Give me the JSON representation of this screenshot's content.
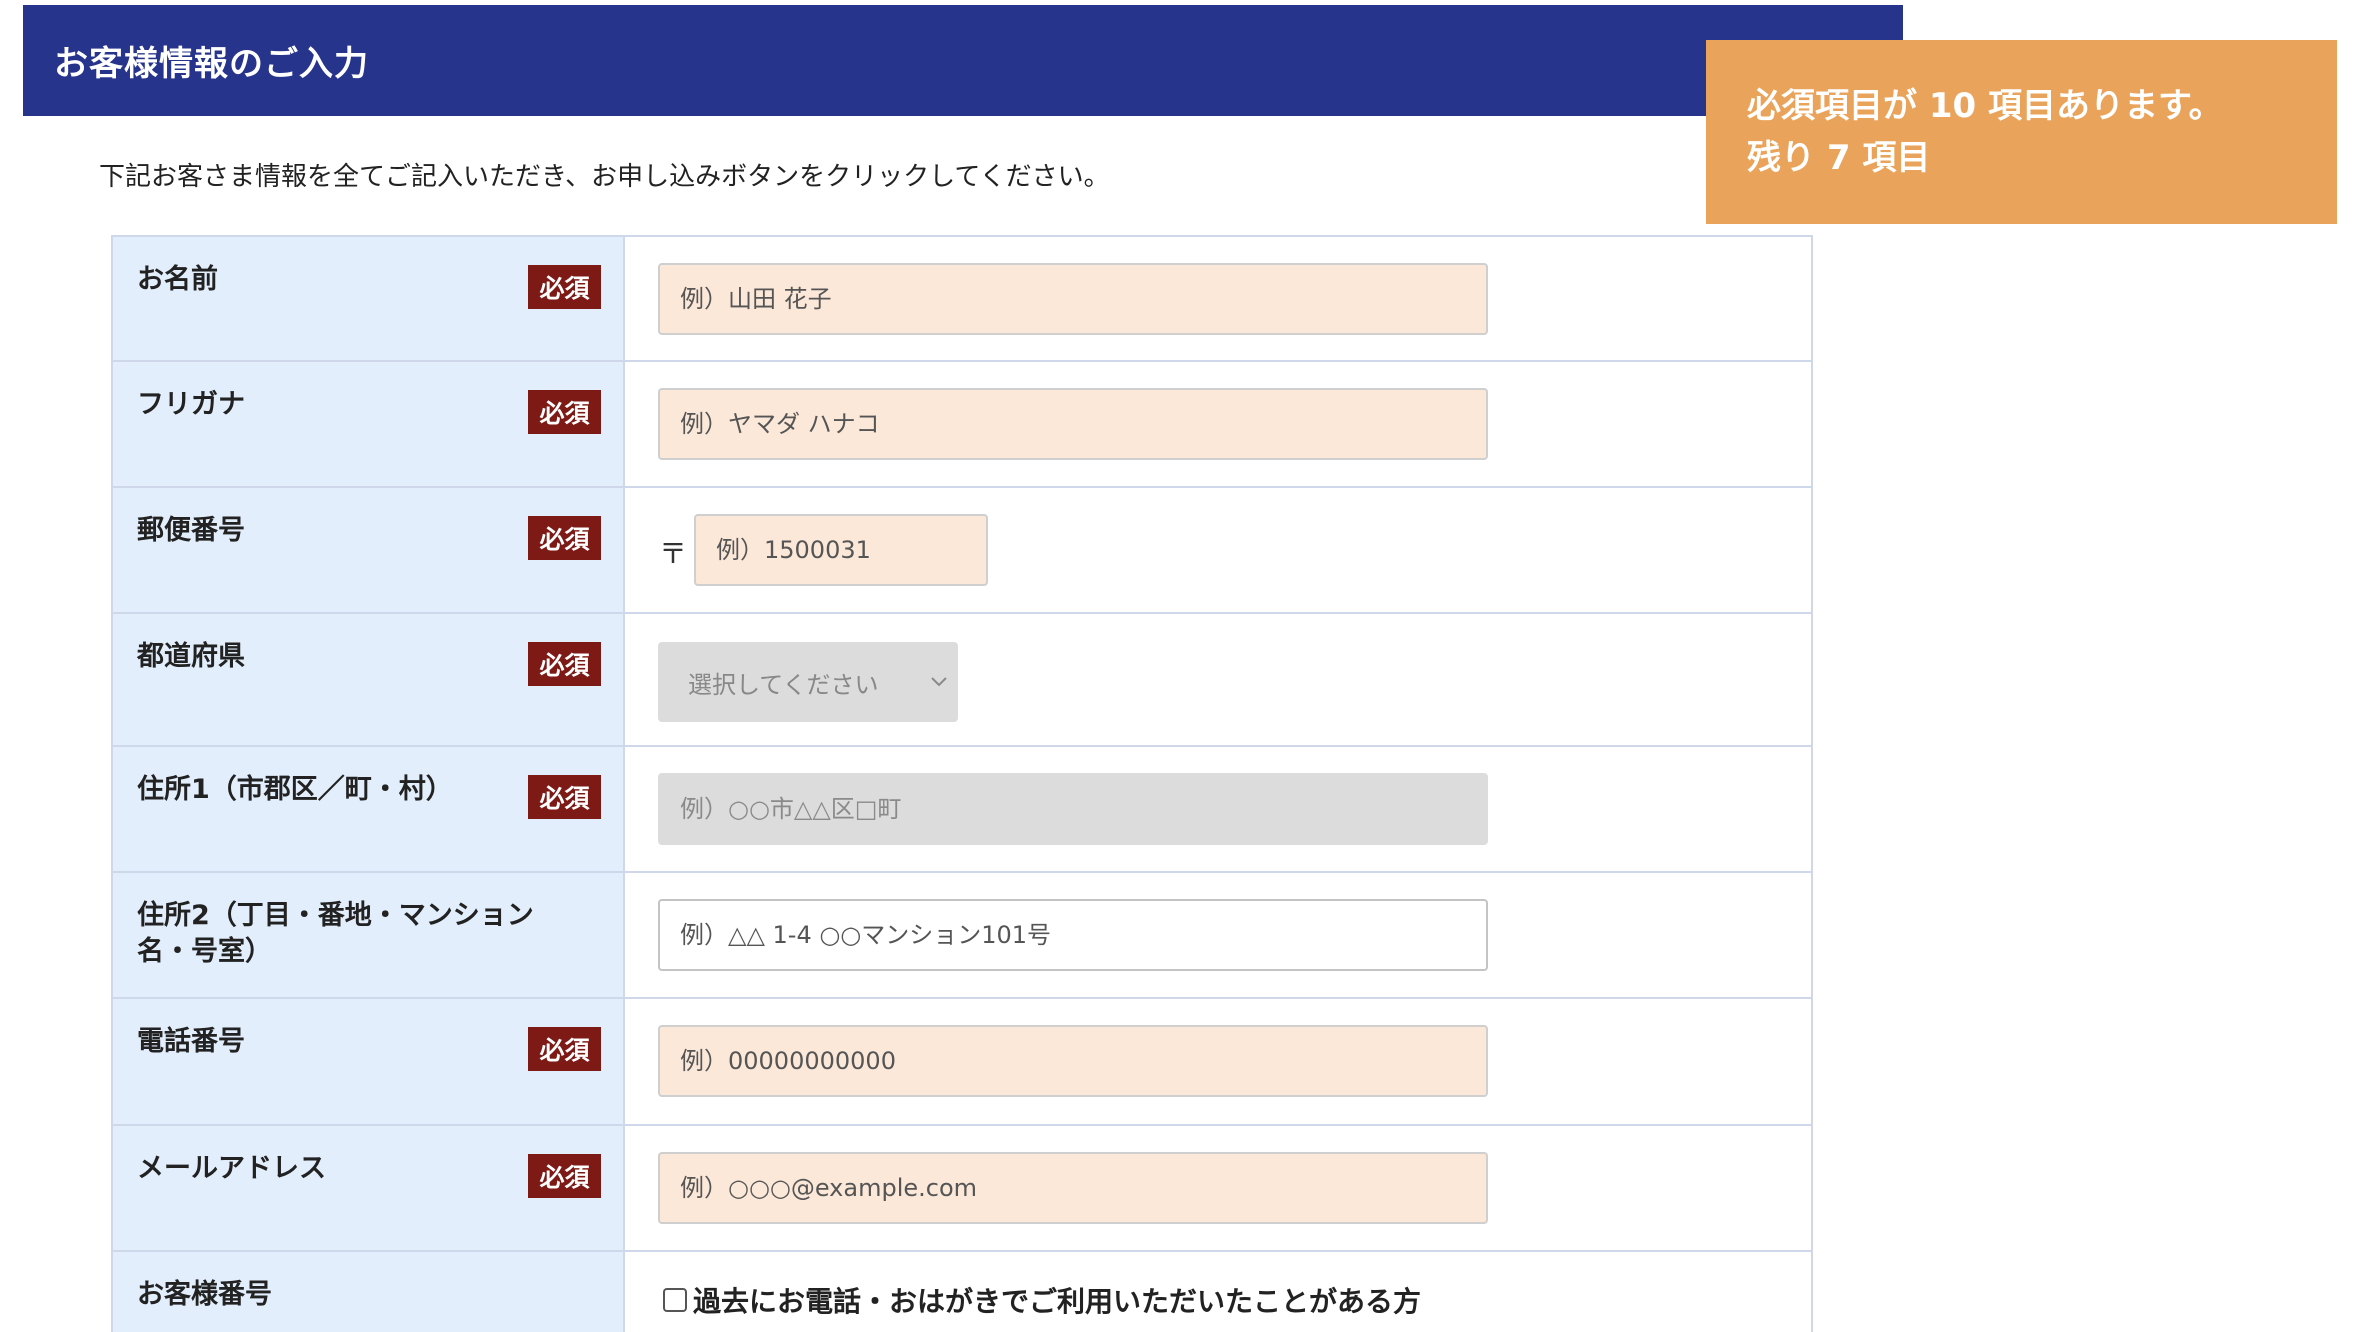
{
  "header": {
    "title": "お客様情報のご入力"
  },
  "notice": {
    "line1": "必須項目が 10 項目あります。",
    "line2": "残り 7 項目"
  },
  "intro": "下記お客さま情報を全てご記入いただき、お申し込みボタンをクリックしてください。",
  "required_badge": "必須",
  "fields": {
    "name": {
      "label": "お名前",
      "placeholder": "例）山田 花子"
    },
    "furigana": {
      "label": "フリガナ",
      "placeholder": "例）ヤマダ ハナコ"
    },
    "postal": {
      "label": "郵便番号",
      "mark": "〒",
      "placeholder": "例）1500031"
    },
    "prefecture": {
      "label": "都道府県",
      "selected": "選択してください"
    },
    "address1": {
      "label": "住所1（市郡区／町・村）",
      "placeholder": "例）○○市△△区□町"
    },
    "address2": {
      "label": "住所2（丁目・番地・マンション名・号室）",
      "placeholder": "例）△△ 1-4 ○○マンション101号"
    },
    "phone": {
      "label": "電話番号",
      "placeholder": "例）00000000000"
    },
    "email": {
      "label": "メールアドレス",
      "placeholder": "例）○○○@example.com"
    },
    "customer_number": {
      "label": "お客様番号",
      "checkbox_label": "過去にお電話・おはがきでご利用いただいたことがある方"
    }
  },
  "colors": {
    "header_bg": "#26348c",
    "notice_bg": "#e9a35b",
    "badge_bg": "#7e1a16",
    "label_bg": "#e3eefc",
    "input_bg": "#fbe8d9",
    "disabled_bg": "#dcdcdc"
  }
}
